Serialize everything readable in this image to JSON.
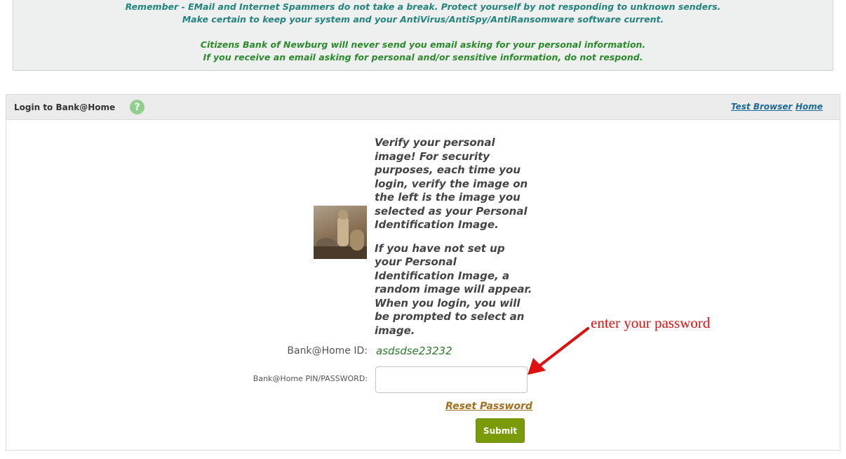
{
  "notice": {
    "line1": "Remember - EMail and Internet Spammers do not take a break. Protect yourself by not responding to unknown senders.",
    "line2": "Make certain to keep your system and your AntiVirus/AntiSpy/AntiRansomware software current.",
    "line3": "Citizens Bank of Newburg will never send you email asking for your personal information.",
    "line4": "If you receive an email asking for personal and/or sensitive information, do not respond."
  },
  "panel": {
    "title": "Login to Bank@Home",
    "help_icon": "question-mark-icon",
    "help_glyph": "?",
    "links": {
      "test_browser": "Test Browser",
      "home": "Home"
    }
  },
  "verify": {
    "image_name": "meerkat-image",
    "paragraph1": "Verify your personal image! For security purposes, each time you login, verify the image on the left is the image you selected as your Personal Identification Image.",
    "paragraph2": "If you have not set up your Personal Identification Image, a random image will appear. When you login, you will be prompted to select an image."
  },
  "form": {
    "id_label": "Bank@Home ID:",
    "id_value": "asdsdse23232",
    "password_label": "Bank@Home PIN/PASSWORD:",
    "password_value": "",
    "reset_label": "Reset Password",
    "submit_label": "Submit"
  },
  "annotation": {
    "text": "enter your password",
    "color": "#e01010"
  },
  "colors": {
    "notice_teal": "#23837d",
    "notice_green": "#2c8a2c",
    "link_blue": "#1d6a96",
    "submit_green": "#7a9a08",
    "reset_gold": "#a0701f"
  }
}
